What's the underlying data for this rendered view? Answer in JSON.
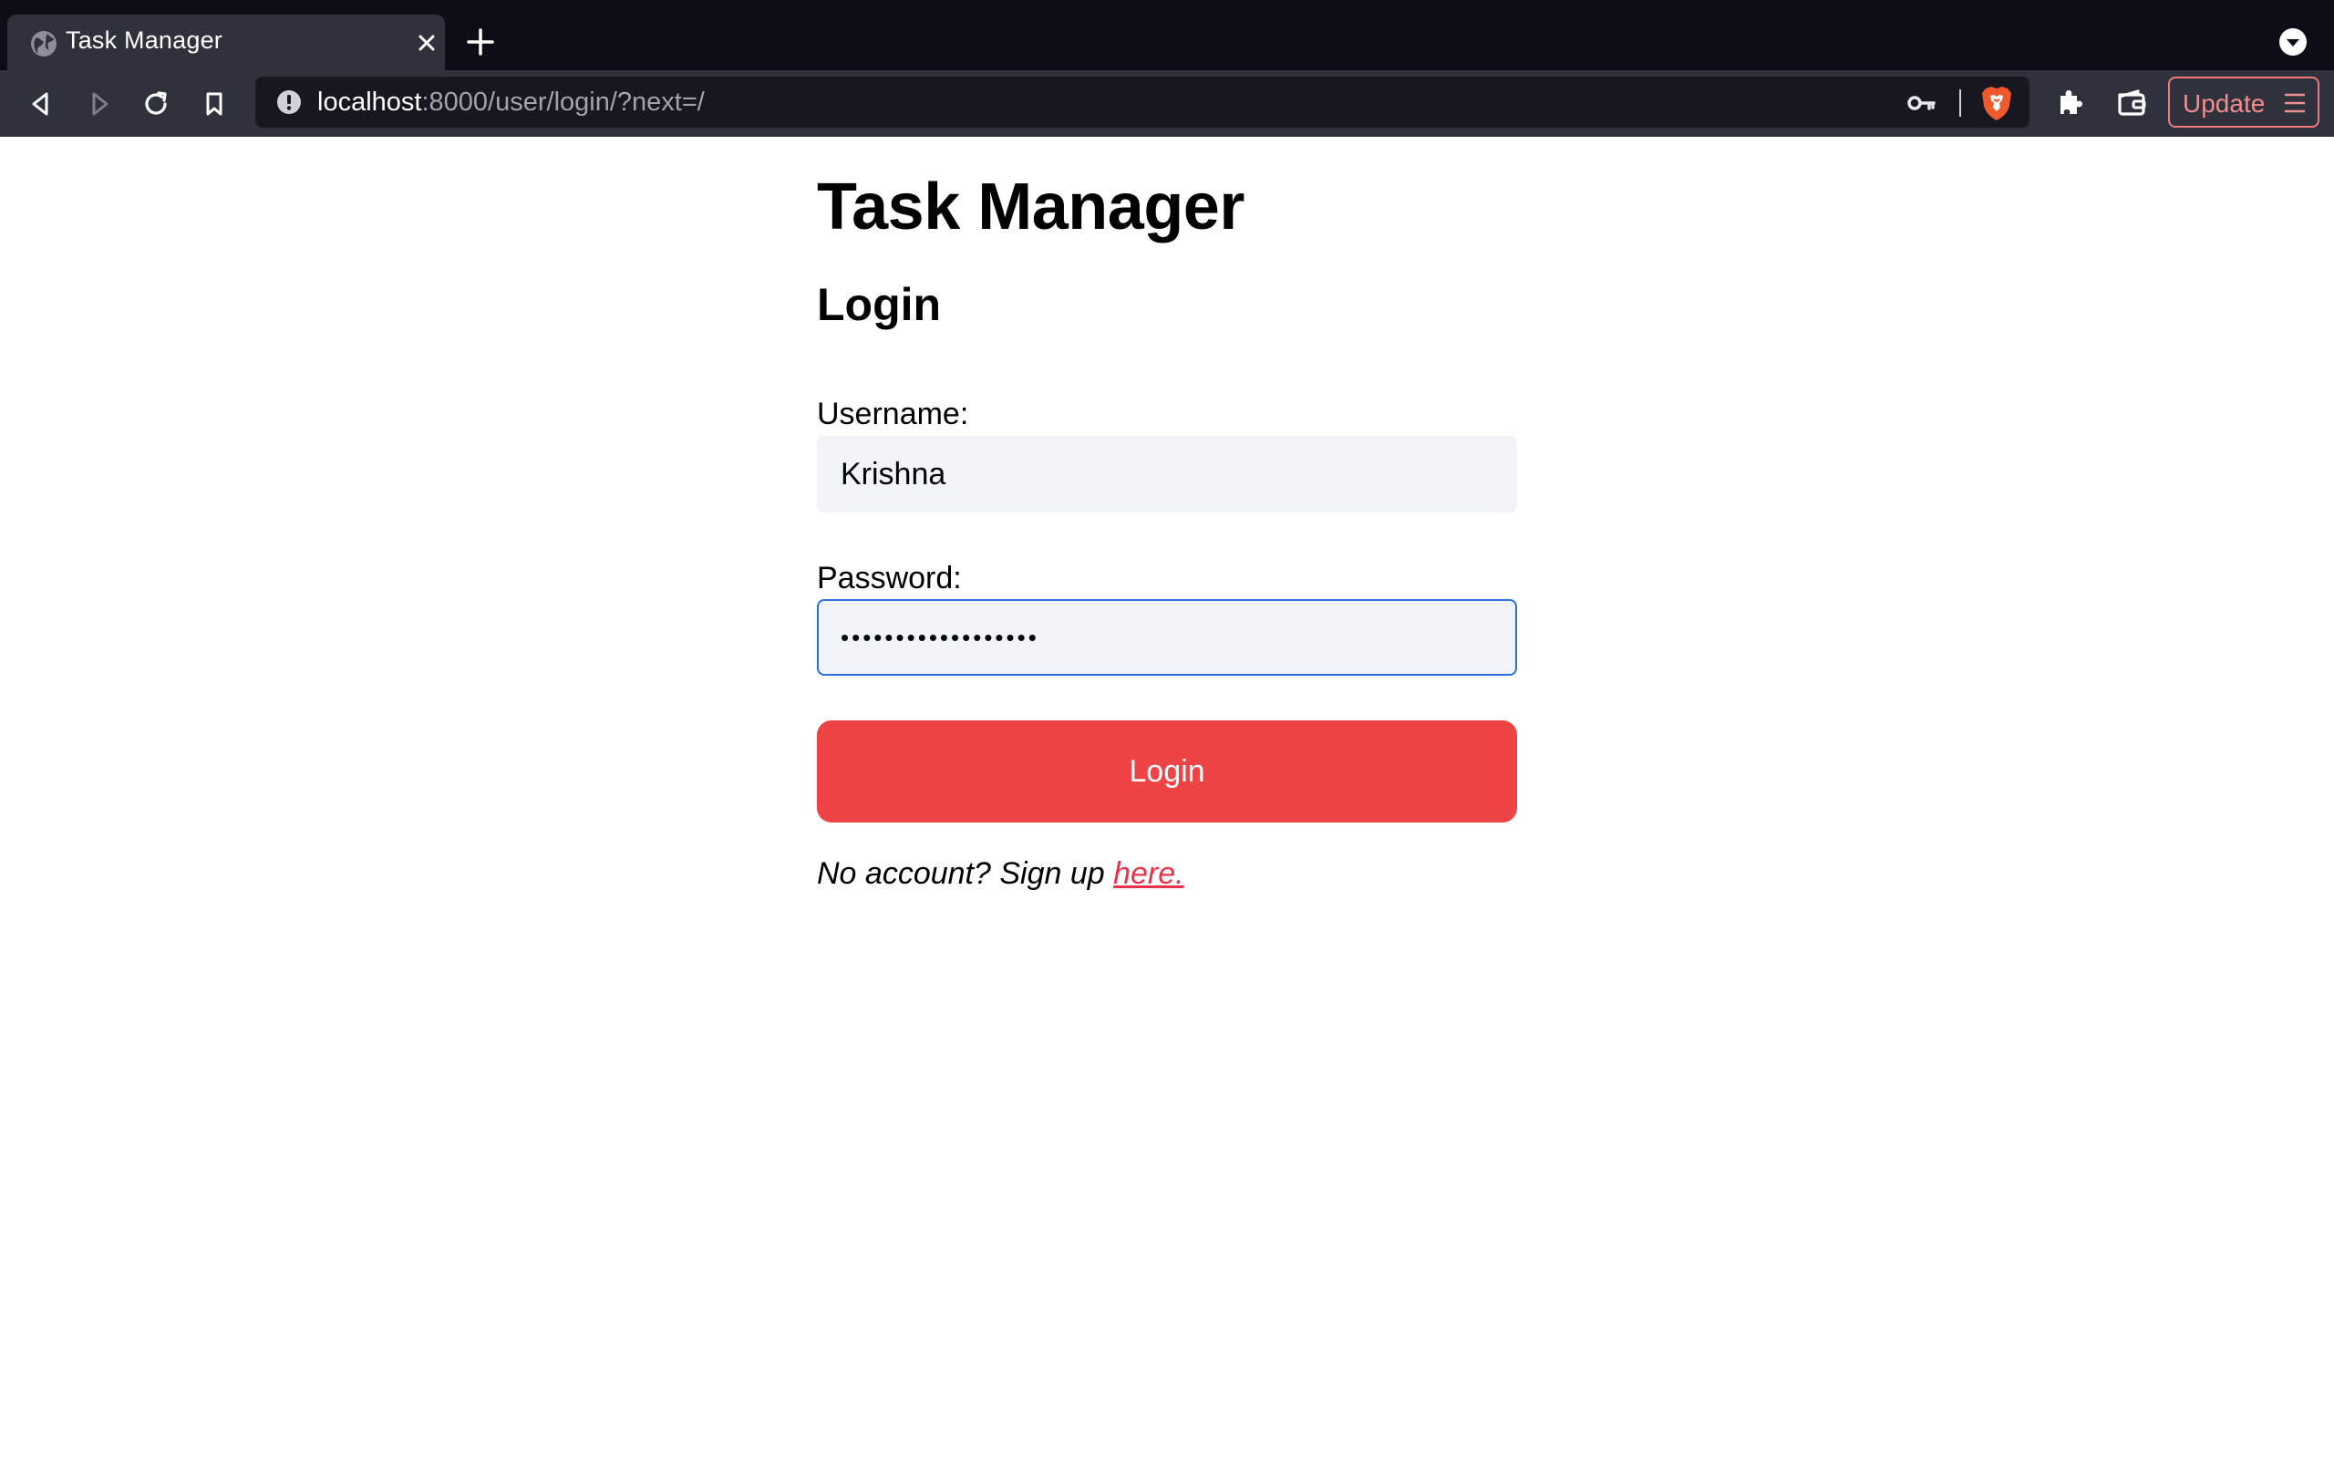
{
  "browser": {
    "tab": {
      "title": "Task Manager"
    },
    "address_bar": {
      "host": "localhost",
      "path": ":8000/user/login/?next=/"
    },
    "update_button": {
      "label": "Update"
    },
    "colors": {
      "tabstrip": "#0c0d17",
      "toolbar": "#2f323c",
      "omnibox": "#17181f",
      "update_accent": "#f0787a"
    }
  },
  "page": {
    "app_title": "Task Manager",
    "section_title": "Login",
    "username": {
      "label": "Username:",
      "value": "Krishna"
    },
    "password": {
      "label": "Password:",
      "value": "••••••••••••••••••"
    },
    "submit": {
      "label": "Login"
    },
    "signup": {
      "prompt": "No account? Sign up ",
      "link_text": "here."
    },
    "colors": {
      "primary_button": "#ef4446",
      "link": "#e8344a",
      "input_bg": "#f0f4f8",
      "focus_border": "#2f6fe0"
    }
  }
}
